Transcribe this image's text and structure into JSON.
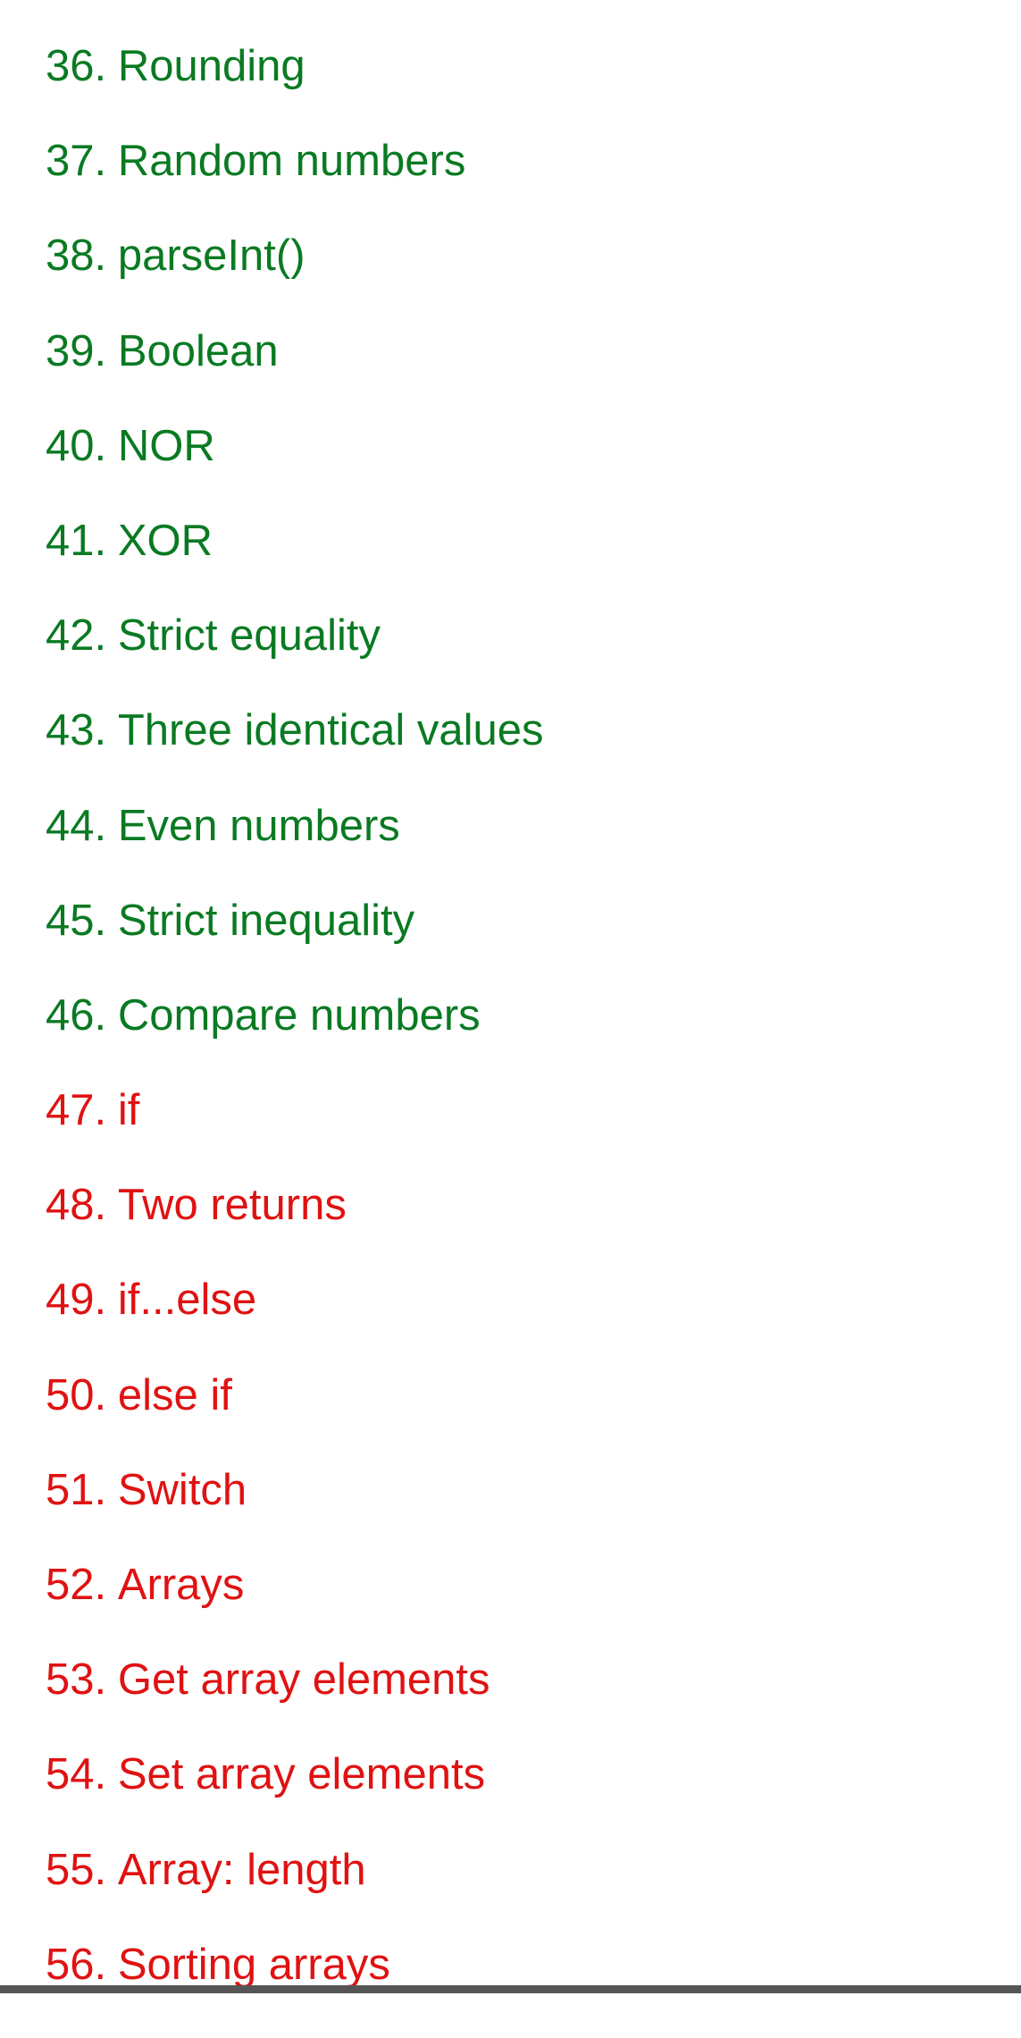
{
  "colors": {
    "completed": "#0a7a22",
    "pending": "#e01212",
    "bottom_bar": "#555555"
  },
  "lessons": [
    {
      "number": "36.",
      "title": "Rounding",
      "status": "completed"
    },
    {
      "number": "37.",
      "title": "Random numbers",
      "status": "completed"
    },
    {
      "number": "38.",
      "title": "parseInt()",
      "status": "completed"
    },
    {
      "number": "39.",
      "title": "Boolean",
      "status": "completed"
    },
    {
      "number": "40.",
      "title": "NOR",
      "status": "completed"
    },
    {
      "number": "41.",
      "title": "XOR",
      "status": "completed"
    },
    {
      "number": "42.",
      "title": "Strict equality",
      "status": "completed"
    },
    {
      "number": "43.",
      "title": "Three identical values",
      "status": "completed"
    },
    {
      "number": "44.",
      "title": "Even numbers",
      "status": "completed"
    },
    {
      "number": "45.",
      "title": "Strict inequality",
      "status": "completed"
    },
    {
      "number": "46.",
      "title": "Compare numbers",
      "status": "completed"
    },
    {
      "number": "47.",
      "title": "if",
      "status": "pending"
    },
    {
      "number": "48.",
      "title": "Two returns",
      "status": "pending"
    },
    {
      "number": "49.",
      "title": "if...else",
      "status": "pending"
    },
    {
      "number": "50.",
      "title": "else if",
      "status": "pending"
    },
    {
      "number": "51.",
      "title": "Switch",
      "status": "pending"
    },
    {
      "number": "52.",
      "title": "Arrays",
      "status": "pending"
    },
    {
      "number": "53.",
      "title": "Get array elements",
      "status": "pending"
    },
    {
      "number": "54.",
      "title": "Set array elements",
      "status": "pending"
    },
    {
      "number": "55.",
      "title": "Array: length",
      "status": "pending"
    },
    {
      "number": "56.",
      "title": "Sorting arrays",
      "status": "pending"
    }
  ]
}
